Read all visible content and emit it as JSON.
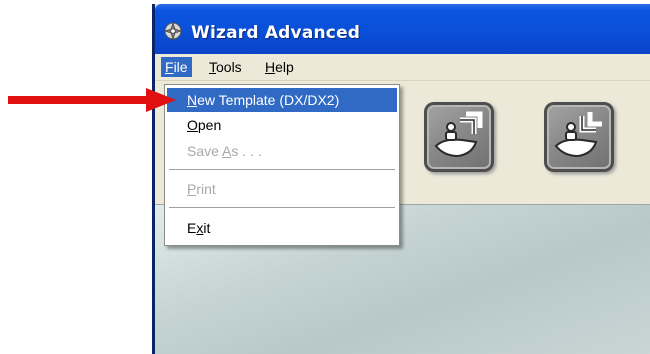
{
  "window": {
    "title": "Wizard Advanced",
    "icon": "wizard-app-icon"
  },
  "menubar": {
    "items": [
      {
        "label": "File",
        "accel": "F",
        "rest": "ile",
        "active": true
      },
      {
        "label": "Tools",
        "accel": "T",
        "rest": "ools",
        "active": false
      },
      {
        "label": "Help",
        "accel": "H",
        "rest": "elp",
        "active": false
      }
    ]
  },
  "file_menu": {
    "items": [
      {
        "label": "New Template (DX/DX2)",
        "accel": "N",
        "rest": "ew Template (DX/DX2)",
        "state": "highlighted"
      },
      {
        "label": "Open",
        "accel": "O",
        "rest": "pen",
        "state": "enabled"
      },
      {
        "label": "Save As . . .",
        "pre": "Save ",
        "accel": "A",
        "rest": "s . . .",
        "state": "disabled"
      },
      {
        "label": "Print",
        "accel": "P",
        "rest": "rint",
        "state": "disabled"
      },
      {
        "label": "Exit",
        "pre": "E",
        "accel": "x",
        "rest": "it",
        "state": "enabled"
      }
    ]
  },
  "toolbar": {
    "buttons": [
      {
        "icon": "export-boat-icon"
      },
      {
        "icon": "import-boat-icon"
      }
    ]
  },
  "annotation": {
    "arrow_color": "#e01010",
    "highlight_color": "#316ac5",
    "title_bar_color": "#0a4fd8"
  }
}
